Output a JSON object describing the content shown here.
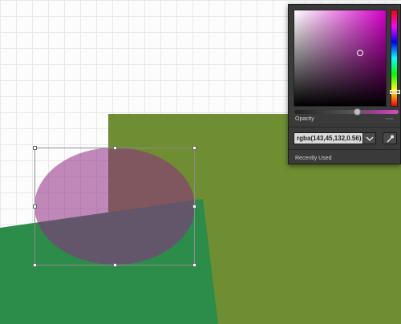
{
  "canvas": {
    "shapes": {
      "olive_rect_color": "#6f8e31",
      "green_polygon_color": "#2c8c49",
      "ellipse_fill": "rgba(143,45,132,0.56)"
    }
  },
  "color_picker": {
    "opacity_label": "Opacity",
    "opacity_ticks": "ᵀᴿᴬᴺˢ",
    "color_value": "rgba(143,45,132,0.56)",
    "recently_used_label": "Recently Used",
    "opacity_value": 0.56,
    "hue_color": "#d400c8",
    "dropdown_icon": "chevron-down-icon",
    "eyedropper_icon": "eyedropper-icon"
  }
}
